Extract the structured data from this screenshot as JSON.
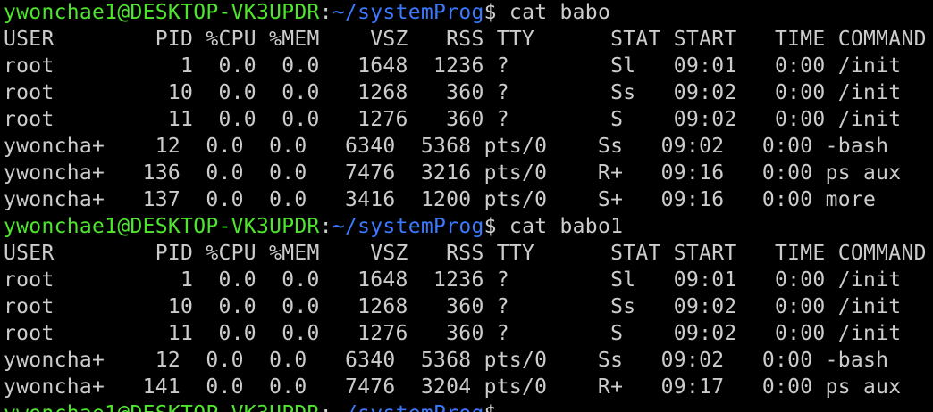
{
  "colors": {
    "background": "#000000",
    "foreground": "#cccccc",
    "prompt_user": "#4ee62d",
    "prompt_path": "#3b78ff"
  },
  "prompt": {
    "user_host": "ywonchae1@DESKTOP-VK3UPDR",
    "colon": ":",
    "path": "~/systemProg",
    "symbol": "$"
  },
  "blocks": [
    {
      "command": " cat babo",
      "output": [
        "USER        PID %CPU %MEM    VSZ   RSS TTY      STAT START   TIME COMMAND",
        "root          1  0.0  0.0   1648  1236 ?        Sl   09:01   0:00 /init",
        "root         10  0.0  0.0   1268   360 ?        Ss   09:02   0:00 /init",
        "root         11  0.0  0.0   1276   360 ?        S    09:02   0:00 /init",
        "ywoncha+    12  0.0  0.0   6340  5368 pts/0    Ss   09:02   0:00 -bash",
        "ywoncha+   136  0.0  0.0   7476  3216 pts/0    R+   09:16   0:00 ps aux",
        "ywoncha+   137  0.0  0.0   3416  1200 pts/0    S+   09:16   0:00 more"
      ]
    },
    {
      "command": " cat babo1",
      "output": [
        "USER        PID %CPU %MEM    VSZ   RSS TTY      STAT START   TIME COMMAND",
        "root          1  0.0  0.0   1648  1236 ?        Sl   09:01   0:00 /init",
        "root         10  0.0  0.0   1268   360 ?        Ss   09:02   0:00 /init",
        "root         11  0.0  0.0   1276   360 ?        S    09:02   0:00 /init",
        "ywoncha+    12  0.0  0.0   6340  5368 pts/0    Ss   09:02   0:00 -bash",
        "ywoncha+   141  0.0  0.0   7476  3204 pts/0    R+   09:17   0:00 ps aux"
      ]
    },
    {
      "command": "",
      "output": []
    }
  ]
}
